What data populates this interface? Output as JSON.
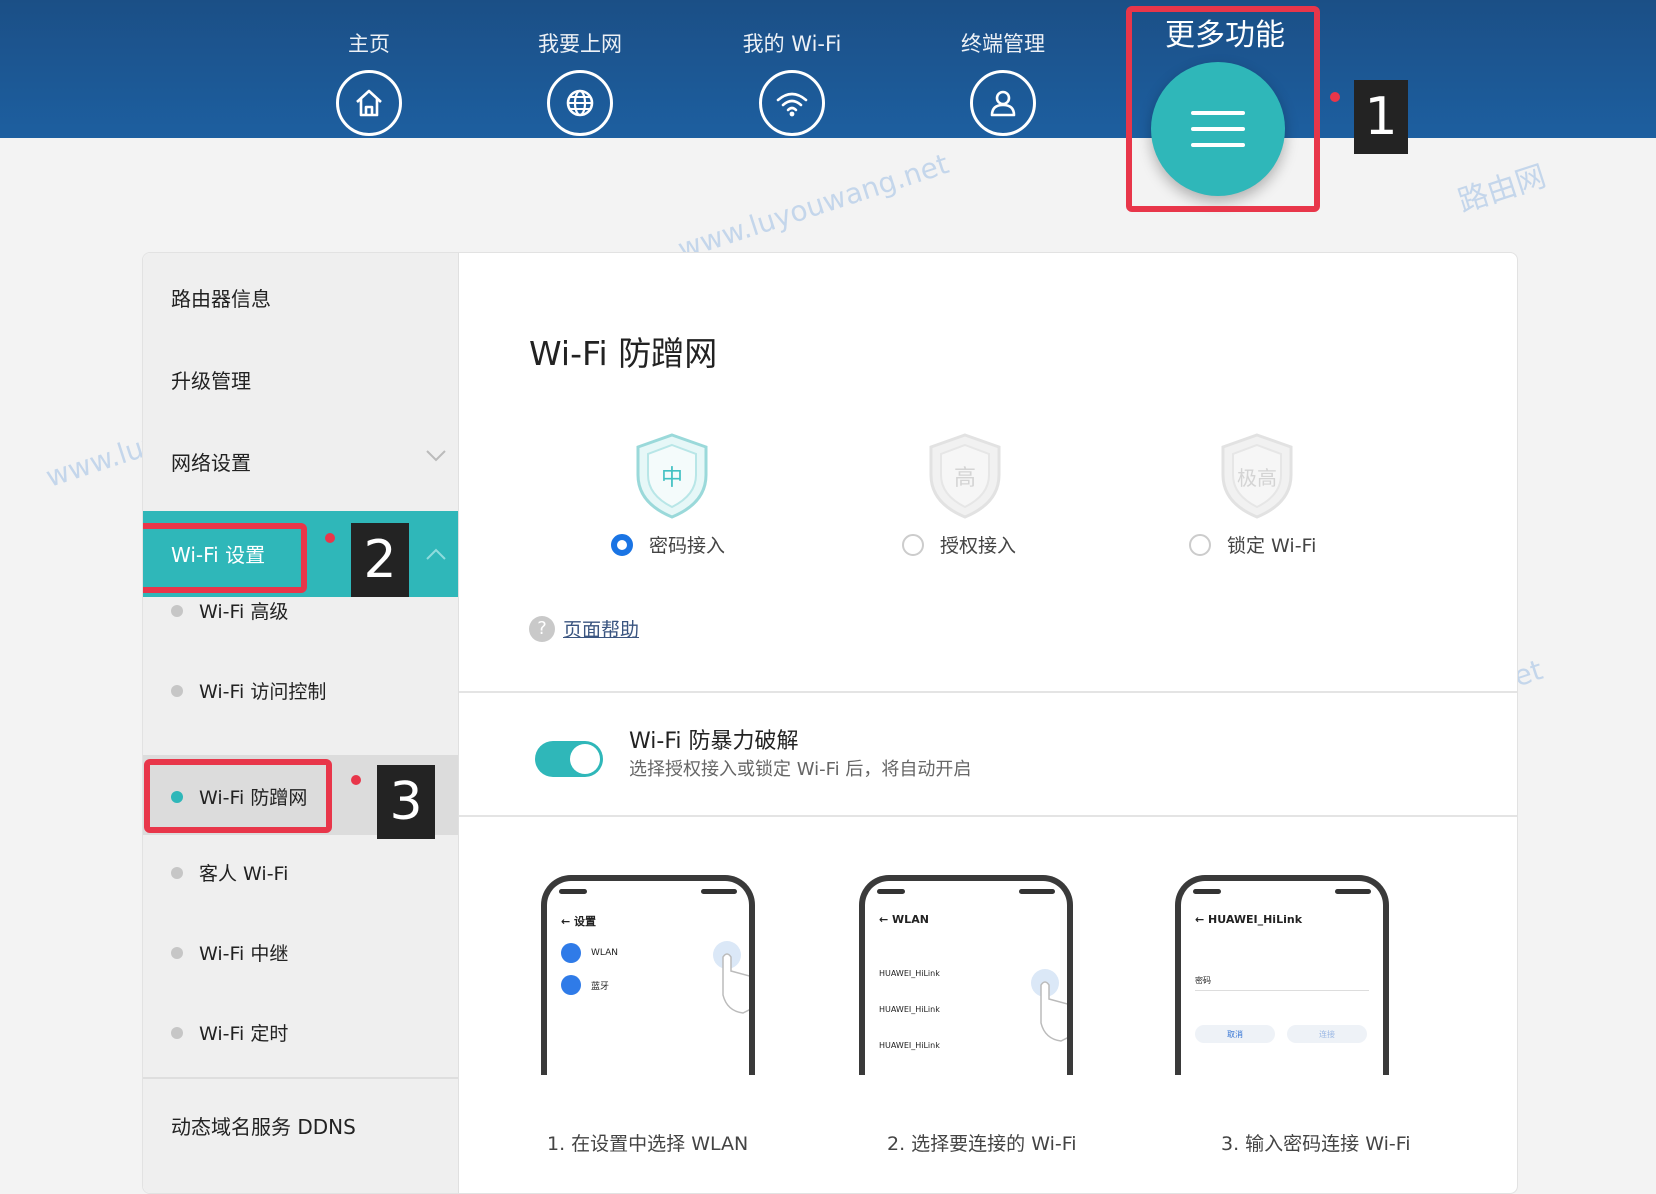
{
  "nav": {
    "items": [
      {
        "label": "主页",
        "icon": "home-icon"
      },
      {
        "label": "我要上网",
        "icon": "globe-icon"
      },
      {
        "label": "我的 Wi-Fi",
        "icon": "wifi-icon"
      },
      {
        "label": "终端管理",
        "icon": "user-icon"
      }
    ],
    "more_label": "更多功能",
    "more_icon": "menu-icon"
  },
  "annotations": [
    "1",
    "2",
    "3"
  ],
  "sidebar": {
    "items": [
      "路由器信息",
      "升级管理",
      "网络设置"
    ],
    "active_group": "Wi-Fi 设置",
    "sub_items": [
      "Wi-Fi 高级",
      "Wi-Fi 访问控制",
      "Wi-Fi 防蹭网",
      "客人 Wi-Fi",
      "Wi-Fi 中继",
      "Wi-Fi 定时"
    ],
    "current": "Wi-Fi 防蹭网",
    "ddns": "动态域名服务 DDNS"
  },
  "content": {
    "title": "Wi-Fi 防蹭网",
    "levels": [
      {
        "shield": "中",
        "label": "密码接入",
        "selected": true
      },
      {
        "shield": "高",
        "label": "授权接入",
        "selected": false
      },
      {
        "shield": "极高",
        "label": "锁定 Wi-Fi",
        "selected": false
      }
    ],
    "help": "页面帮助",
    "brute_force": {
      "title": "Wi-Fi 防暴力破解",
      "desc": "选择授权接入或锁定 Wi-Fi 后，将自动开启",
      "enabled": true
    },
    "phones": [
      {
        "title": "设置",
        "rows": [
          "WLAN",
          "蓝牙"
        ]
      },
      {
        "title": "WLAN",
        "rows": [
          "HUAWEI_HiLink",
          "HUAWEI_HiLink",
          "HUAWEI_HiLink"
        ]
      },
      {
        "title": "HUAWEI_HiLink",
        "rows": [
          "密码"
        ],
        "buttons": [
          "取消",
          "连接"
        ]
      }
    ],
    "steps": [
      "1. 在设置中选择 WLAN",
      "2. 选择要连接的 Wi-Fi",
      "3. 输入密码连接 Wi-Fi"
    ]
  },
  "watermarks": [
    "www.luyouwang.net",
    "路由网"
  ],
  "colors": {
    "accent": "#2fb7b9",
    "topbar": "#1d5fa0",
    "annotation": "#e8364a",
    "radio": "#1a74e4"
  }
}
